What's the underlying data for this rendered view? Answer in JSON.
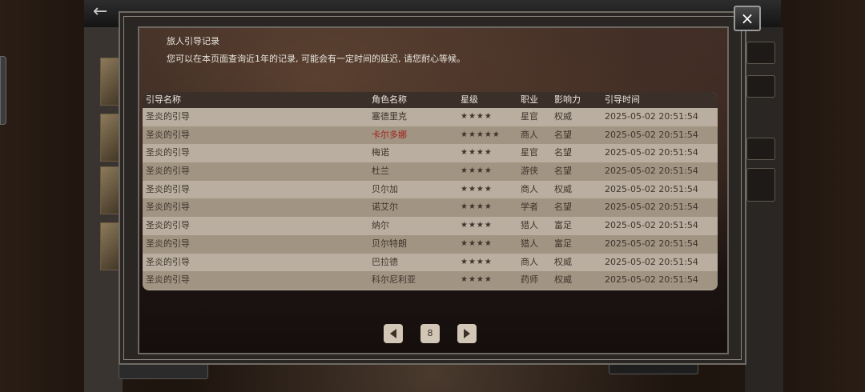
{
  "header": {
    "title": "旅人引导记录",
    "subtitle": "您可以在本页面查询近1年的记录, 可能会有一定时间的延迟, 请您耐心等候。"
  },
  "close_icon": "×",
  "table": {
    "columns": [
      "引导名称",
      "角色名称",
      "星级",
      "职业",
      "影响力",
      "引导时间"
    ],
    "rows": [
      [
        "圣炎的引导",
        "塞德里克",
        "★★★★",
        "星官",
        "权威",
        "2025-05-02 20:51:54"
      ],
      [
        "圣炎的引导",
        "卡尔多娜",
        "★★★★★",
        "商人",
        "名望",
        "2025-05-02 20:51:54"
      ],
      [
        "圣炎的引导",
        "梅诺",
        "★★★★",
        "星官",
        "名望",
        "2025-05-02 20:51:54"
      ],
      [
        "圣炎的引导",
        "杜兰",
        "★★★★",
        "游侠",
        "名望",
        "2025-05-02 20:51:54"
      ],
      [
        "圣炎的引导",
        "贝尔加",
        "★★★★",
        "商人",
        "权威",
        "2025-05-02 20:51:54"
      ],
      [
        "圣炎的引导",
        "诺艾尔",
        "★★★★",
        "学者",
        "名望",
        "2025-05-02 20:51:54"
      ],
      [
        "圣炎的引导",
        "纳尔",
        "★★★★",
        "猎人",
        "富足",
        "2025-05-02 20:51:54"
      ],
      [
        "圣炎的引导",
        "贝尔特朗",
        "★★★★",
        "猎人",
        "富足",
        "2025-05-02 20:51:54"
      ],
      [
        "圣炎的引导",
        "巴拉德",
        "★★★★",
        "商人",
        "权威",
        "2025-05-02 20:51:54"
      ],
      [
        "圣炎的引导",
        "科尔尼利亚",
        "★★★★",
        "药师",
        "权威",
        "2025-05-02 20:51:54"
      ]
    ]
  },
  "pager": {
    "page": "8"
  },
  "colors": {
    "highlight_name": "#a3201b",
    "header_bg": "#3b2f29"
  }
}
